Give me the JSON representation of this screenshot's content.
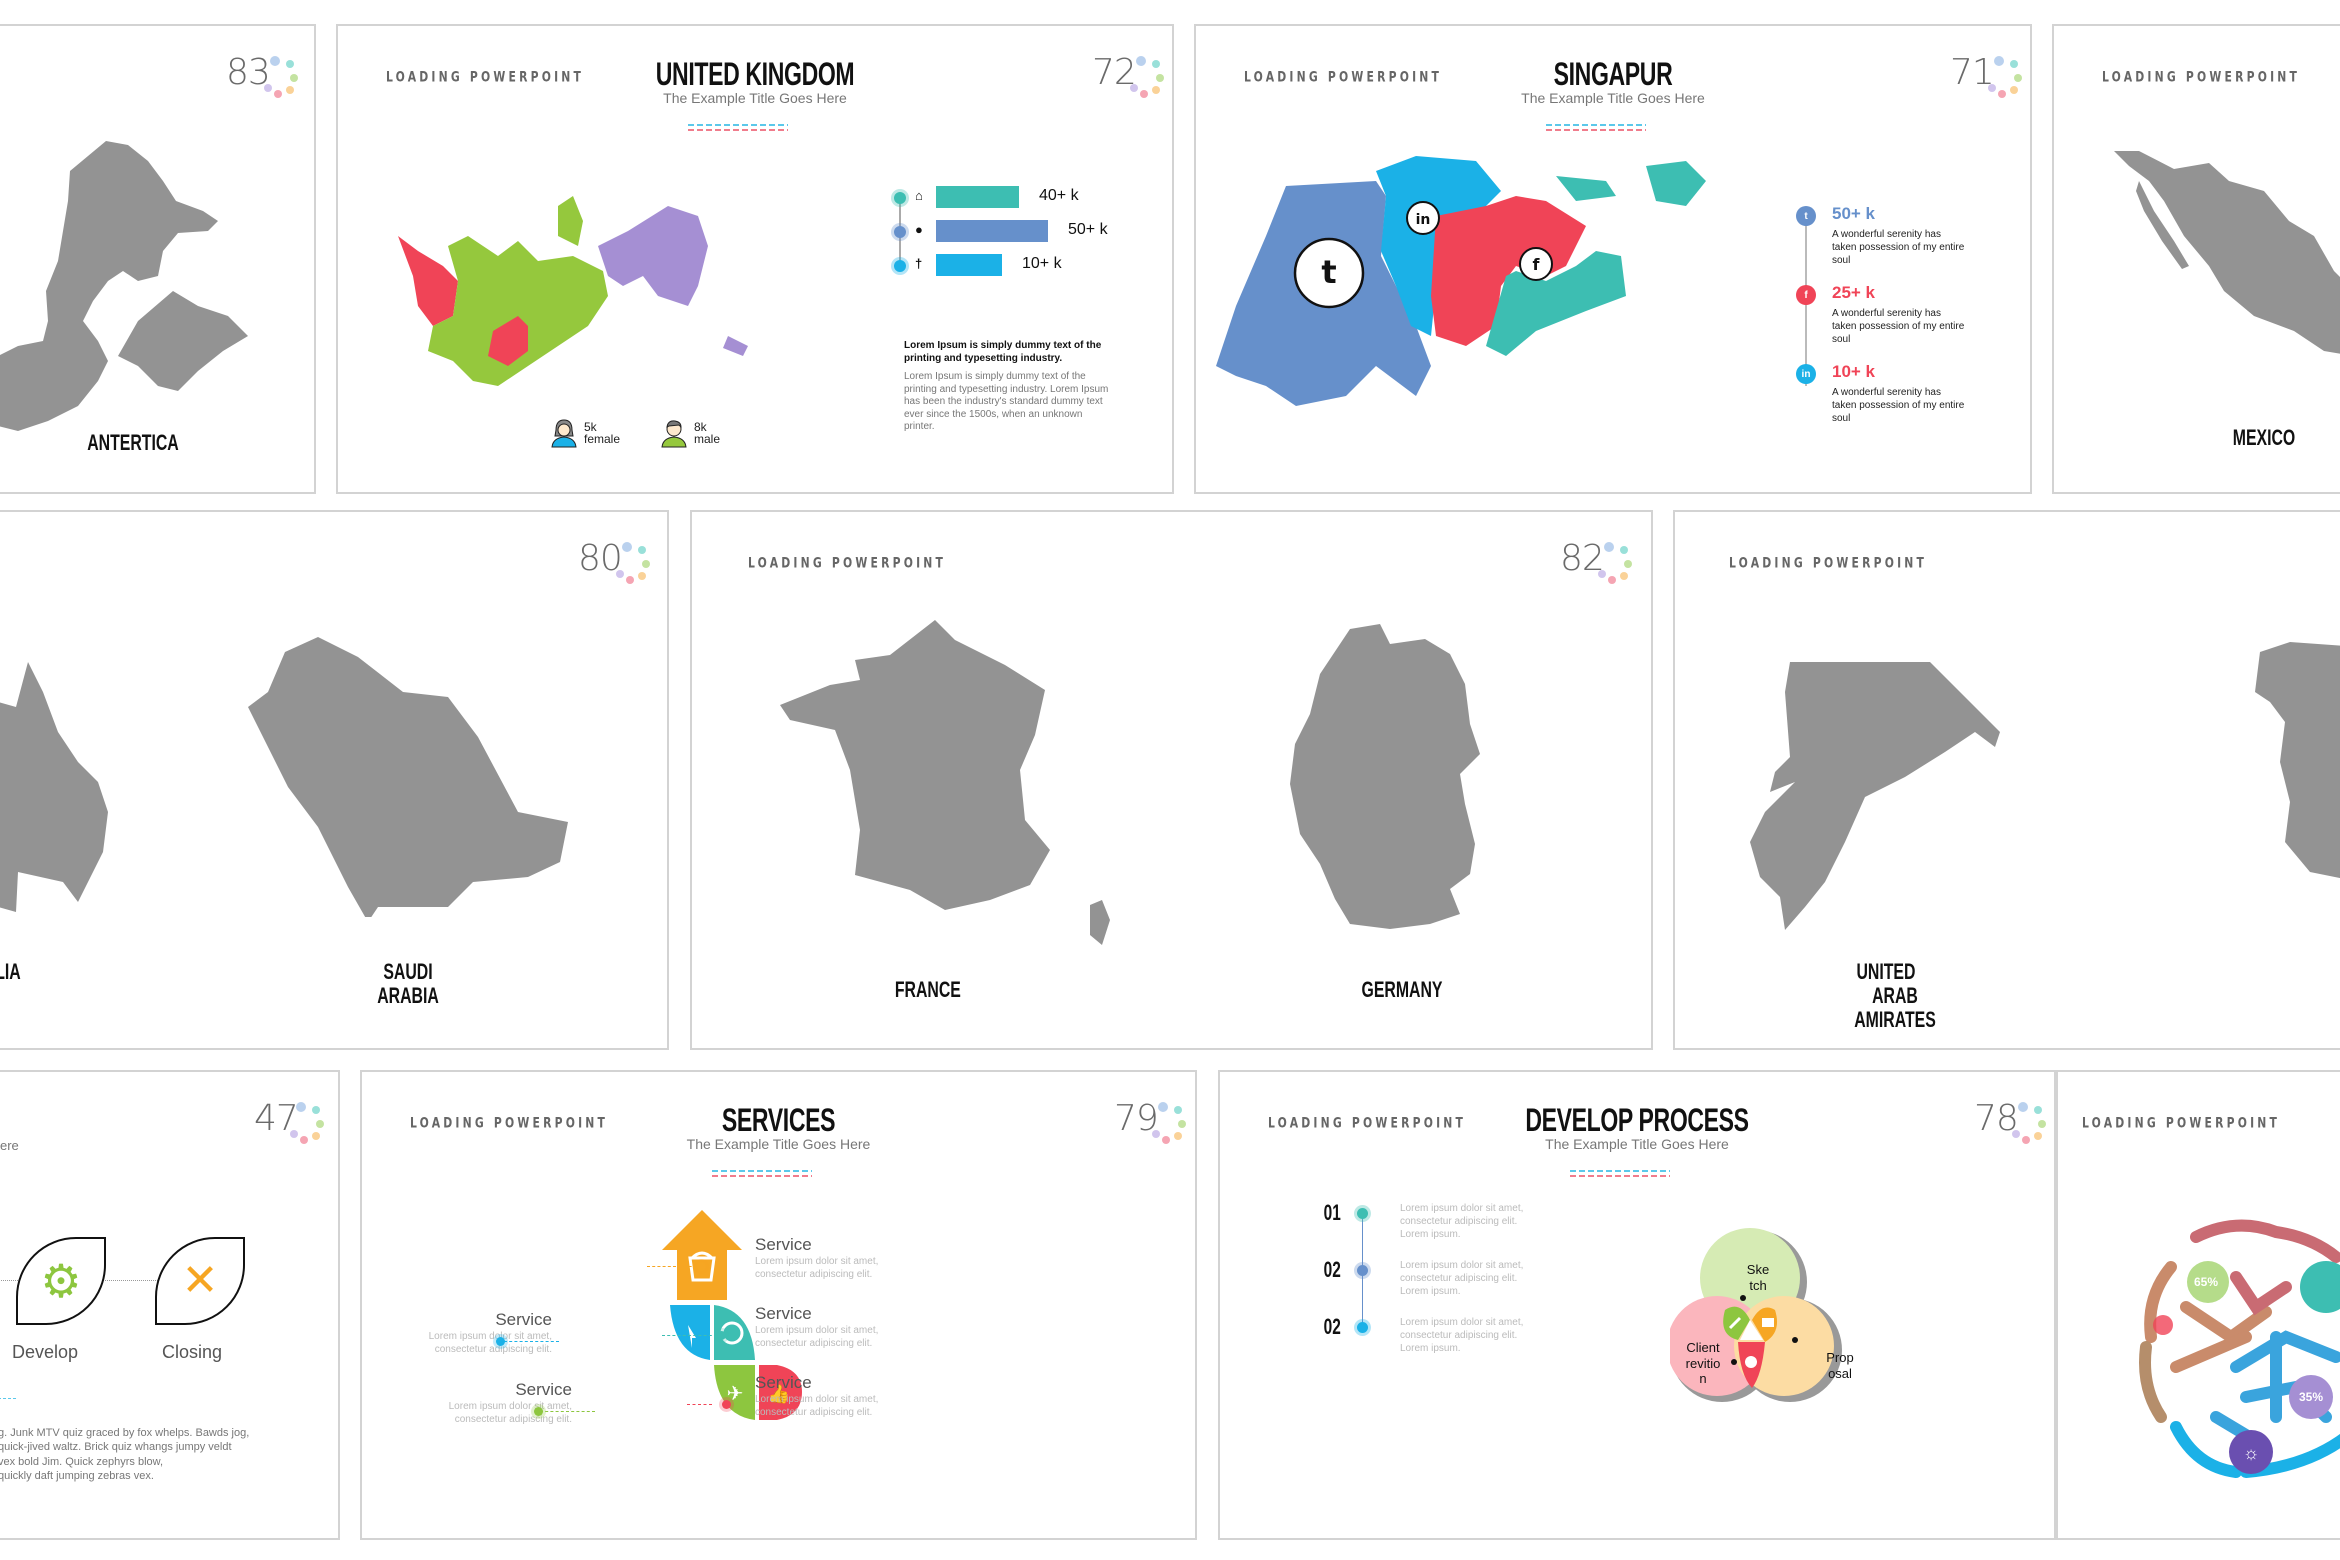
{
  "brand": "LOADING POWERPOINT",
  "subtitle": "The Example Title Goes Here",
  "colors": {
    "teal": "#3dbeb2",
    "blue": "#6690cb",
    "sky": "#1bb1e7",
    "red": "#f04457",
    "green": "#95c83d",
    "purple": "#a58fd3",
    "orange": "#f6a623",
    "map_gray": "#939393",
    "dot_colors": [
      "#a9c5ea",
      "#7fd8cf",
      "#b5dc8a",
      "#f9c77e",
      "#f28ea0",
      "#c5b7e8"
    ]
  },
  "slides": {
    "antertica": {
      "number": "83",
      "country": "ANTERTICA"
    },
    "uk": {
      "number": "72",
      "title": "UNITED KINGDOM",
      "stats": [
        {
          "icon": "home-icon",
          "glyph": "⌂",
          "value": "40+ k",
          "fraction": 0.74,
          "color": "#3dbeb2"
        },
        {
          "icon": "user-icon",
          "glyph": "●",
          "value": "50+ k",
          "fraction": 1.0,
          "color": "#6690cb"
        },
        {
          "icon": "pin-icon",
          "glyph": "†",
          "value": "10+ k",
          "fraction": 0.59,
          "color": "#1bb1e7"
        }
      ],
      "lead_text": "Lorem Ipsum is simply dummy text of the printing and typesetting industry.",
      "body_text": "Lorem Ipsum is simply dummy text of the printing and typesetting industry. Lorem Ipsum has been the industry's standard dummy text ever since the 1500s, when an unknown printer.",
      "people": [
        {
          "icon": "female-avatar-icon",
          "count": "5k",
          "label": "female"
        },
        {
          "icon": "male-avatar-icon",
          "count": "8k",
          "label": "male"
        }
      ]
    },
    "singapur": {
      "number": "71",
      "title": "SINGAPUR",
      "social": [
        {
          "network": "twitter",
          "glyph": "t",
          "value": "50+ k",
          "color": "#6690cb",
          "text": "A wonderful serenity has taken possession of my entire soul"
        },
        {
          "network": "facebook",
          "glyph": "f",
          "value": "25+ k",
          "color": "#f04457",
          "text": "A wonderful serenity has taken possession of my entire soul"
        },
        {
          "network": "linkedin",
          "glyph": "in",
          "value": "10+ k",
          "color": "#f04457",
          "text": "A wonderful serenity has taken possession of my entire soul"
        }
      ],
      "map_badges": [
        "in",
        "f"
      ]
    },
    "mexico": {
      "country": "MEXICO"
    },
    "australia_saudi": {
      "number": "80",
      "countries": [
        "LIA",
        "SAUDI ARABIA"
      ]
    },
    "france_germany": {
      "number": "82",
      "countries": [
        "FRANCE",
        "GERMANY"
      ]
    },
    "uae": {
      "country_line1": "UNITED",
      "country_line2": "ARAB AMIRATES"
    },
    "process47": {
      "number": "47",
      "subtitle_fragment": "ere",
      "steps": [
        {
          "label": "Develop",
          "icon": "gear-icon",
          "color": "#8dc63f"
        },
        {
          "label": "Closing",
          "icon": "close-icon",
          "color": "#f6a623"
        }
      ],
      "paragraph_lines": [
        "g. Junk MTV quiz graced by fox whelps. Bawds jog,",
        "quick-jived waltz. Brick quiz whangs jumpy veldt",
        "vex bold Jim. Quick zephyrs blow,",
        "quickly daft jumping zebras vex."
      ]
    },
    "services": {
      "number": "79",
      "title": "SERVICES",
      "items_left": [
        {
          "label": "Service",
          "text1": "Lorem ipsum dolor sit amet,",
          "text2": "consectetur adipiscing elit.",
          "color": "#1bb1e7"
        },
        {
          "label": "Service",
          "text1": "Lorem ipsum dolor sit amet,",
          "text2": "consectetur adipiscing elit.",
          "color": "#8dc63f"
        }
      ],
      "items_right": [
        {
          "label": "Service",
          "text1": "Lorem ipsum dolor sit amet,",
          "text2": "consectetur adipiscing elit.",
          "color": "#f6a623"
        },
        {
          "label": "Service",
          "text1": "Lorem ipsum dolor sit amet,",
          "text2": "consectetur adipiscing elit.",
          "color": "#3dbeb2"
        },
        {
          "label": "Service",
          "text1": "Lorem ipsum dolor sit amet,",
          "text2": "consectetur adipiscing elit.",
          "color": "#f04457"
        }
      ]
    },
    "develop": {
      "number": "78",
      "title": "DEVELOP PROCESS",
      "steps": [
        {
          "num": "01",
          "color": "#3dbeb2",
          "lines": [
            "Lorem ipsum dolor sit amet,",
            "consectetur adipiscing elit.",
            "Lorem ipsum."
          ]
        },
        {
          "num": "02",
          "color": "#6690cb",
          "lines": [
            "Lorem ipsum dolor sit amet,",
            "consectetur adipiscing elit.",
            "Lorem ipsum."
          ]
        },
        {
          "num": "02",
          "color": "#1bb1e7",
          "lines": [
            "Lorem ipsum dolor sit amet,",
            "consectetur adipiscing elit.",
            "Lorem ipsum."
          ]
        }
      ],
      "venn": [
        {
          "line1": "Ske",
          "line2": "tch",
          "line3": ""
        },
        {
          "line1": "Client",
          "line2": "revitio",
          "line3": "n"
        },
        {
          "line1": "Prop",
          "line2": "osal",
          "line3": ""
        }
      ]
    },
    "brain": {
      "badges": [
        "65%",
        "35%"
      ]
    }
  }
}
